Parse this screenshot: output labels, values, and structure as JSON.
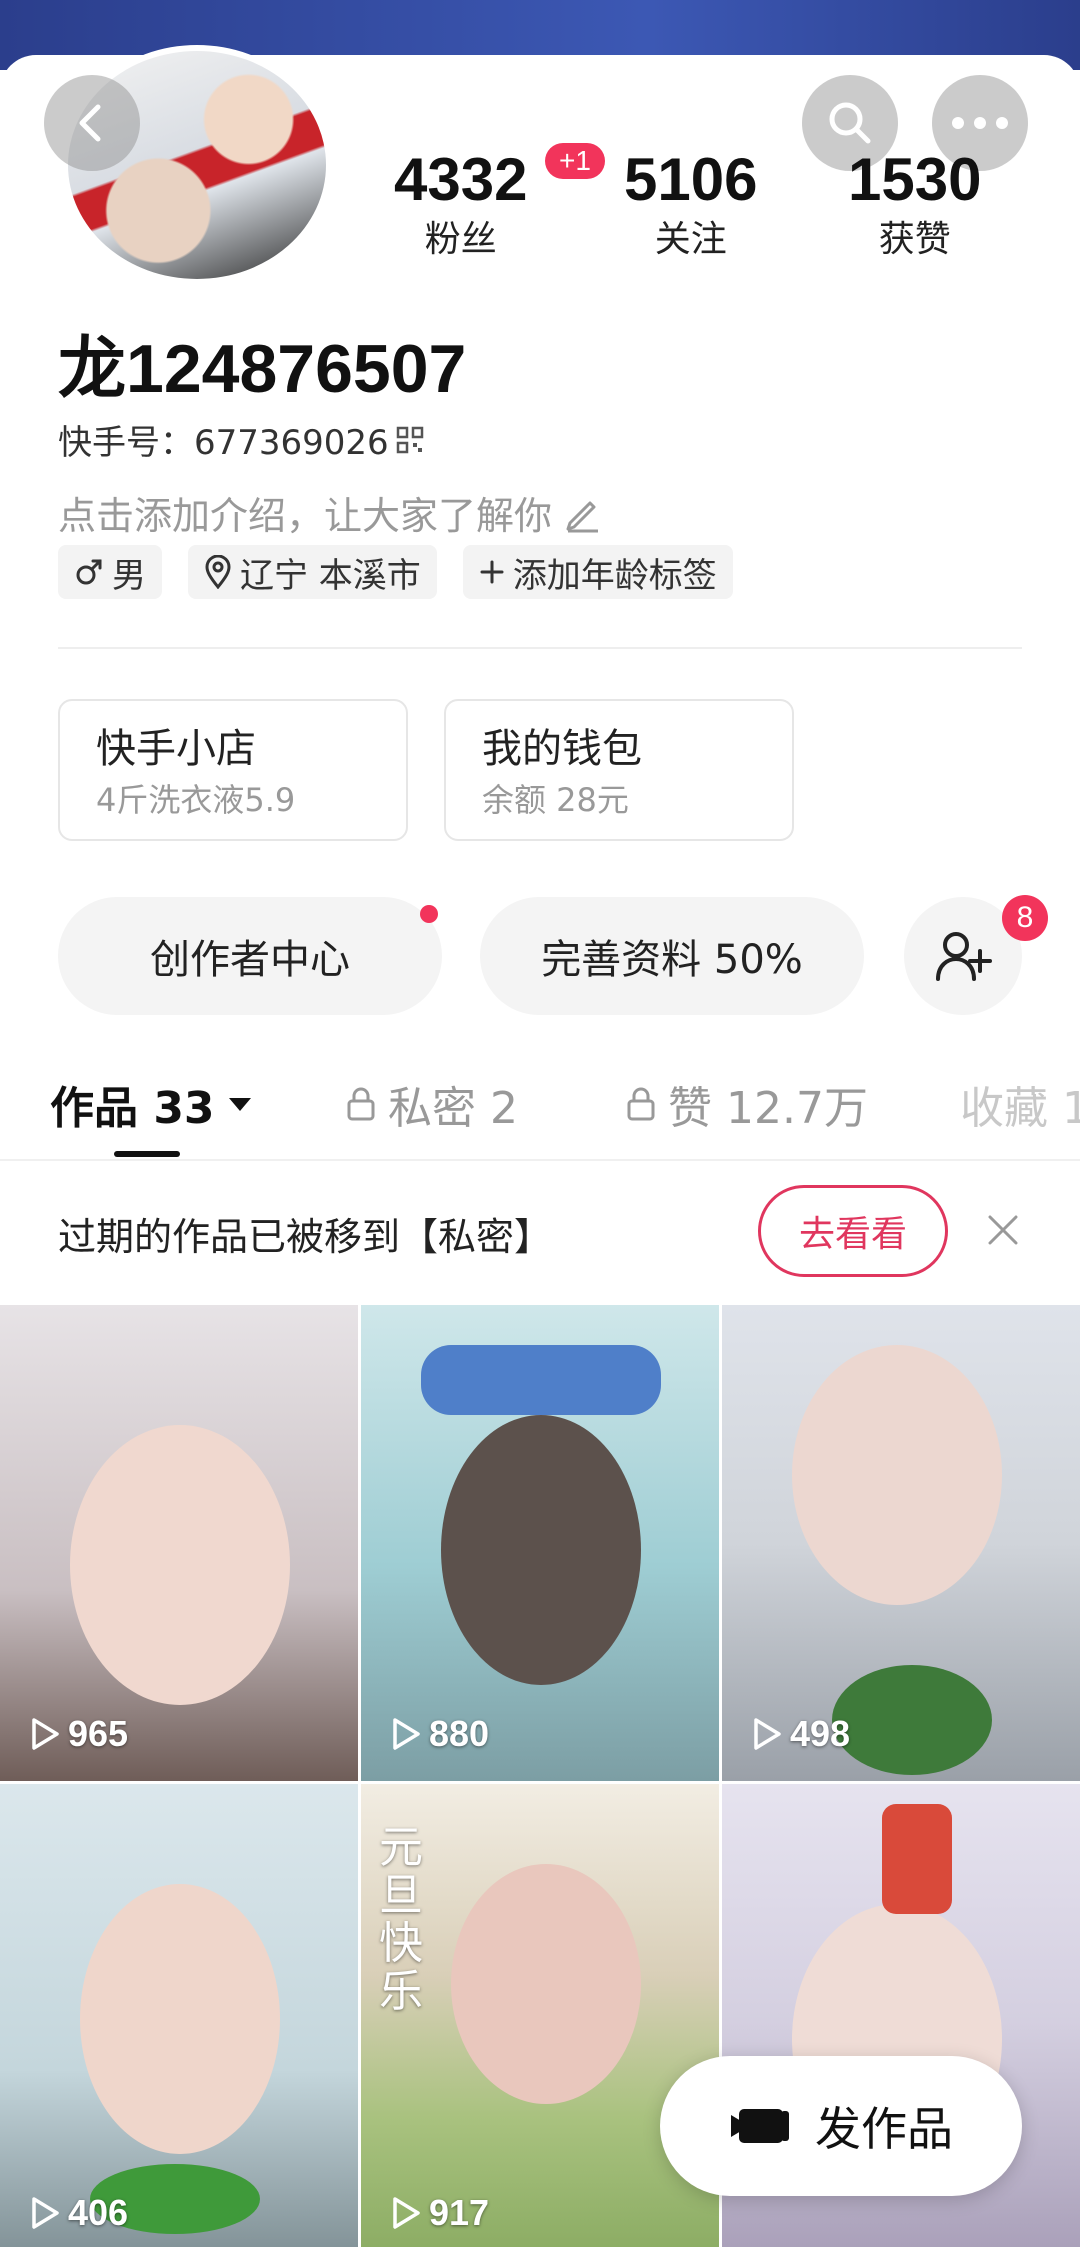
{
  "profile": {
    "username": "龙124876507",
    "kuaishou_id_label": "快手号：677369026",
    "bio_placeholder": "点击添加介绍，让大家了解你",
    "stats": [
      {
        "value": "4332",
        "label": "粉丝"
      },
      {
        "value": "5106",
        "label": "关注"
      },
      {
        "value": "1530",
        "label": "获赞"
      }
    ],
    "followers_delta": "+1",
    "tags": {
      "gender": "男",
      "location": "辽宁 本溪市",
      "add_age": "添加年龄标签"
    }
  },
  "cards": {
    "shop": {
      "title": "快手小店",
      "subtitle": "4斤洗衣液5.9"
    },
    "wallet": {
      "title": "我的钱包",
      "subtitle": "余额 28元"
    }
  },
  "actions": {
    "creator_center": "创作者中心",
    "complete_profile": "完善资料 50%",
    "friend_badge": "8"
  },
  "tabs": [
    {
      "label": "作品 33"
    },
    {
      "label": "私密 2"
    },
    {
      "label": "赞 12.7万"
    },
    {
      "label": "收藏 1"
    }
  ],
  "notice": {
    "text": "过期的作品已被移到【私密】",
    "button": "去看看"
  },
  "videos": [
    {
      "views": "965"
    },
    {
      "views": "880"
    },
    {
      "views": "498"
    },
    {
      "views": "406"
    },
    {
      "views": "917"
    },
    {
      "views": ""
    }
  ],
  "overlay_text": {
    "new_year": "元旦快乐"
  },
  "post_button": "发作品",
  "colors": {
    "accent": "#f2345b",
    "notice_button": "#e0365e",
    "banner": "#2b3e8c"
  }
}
